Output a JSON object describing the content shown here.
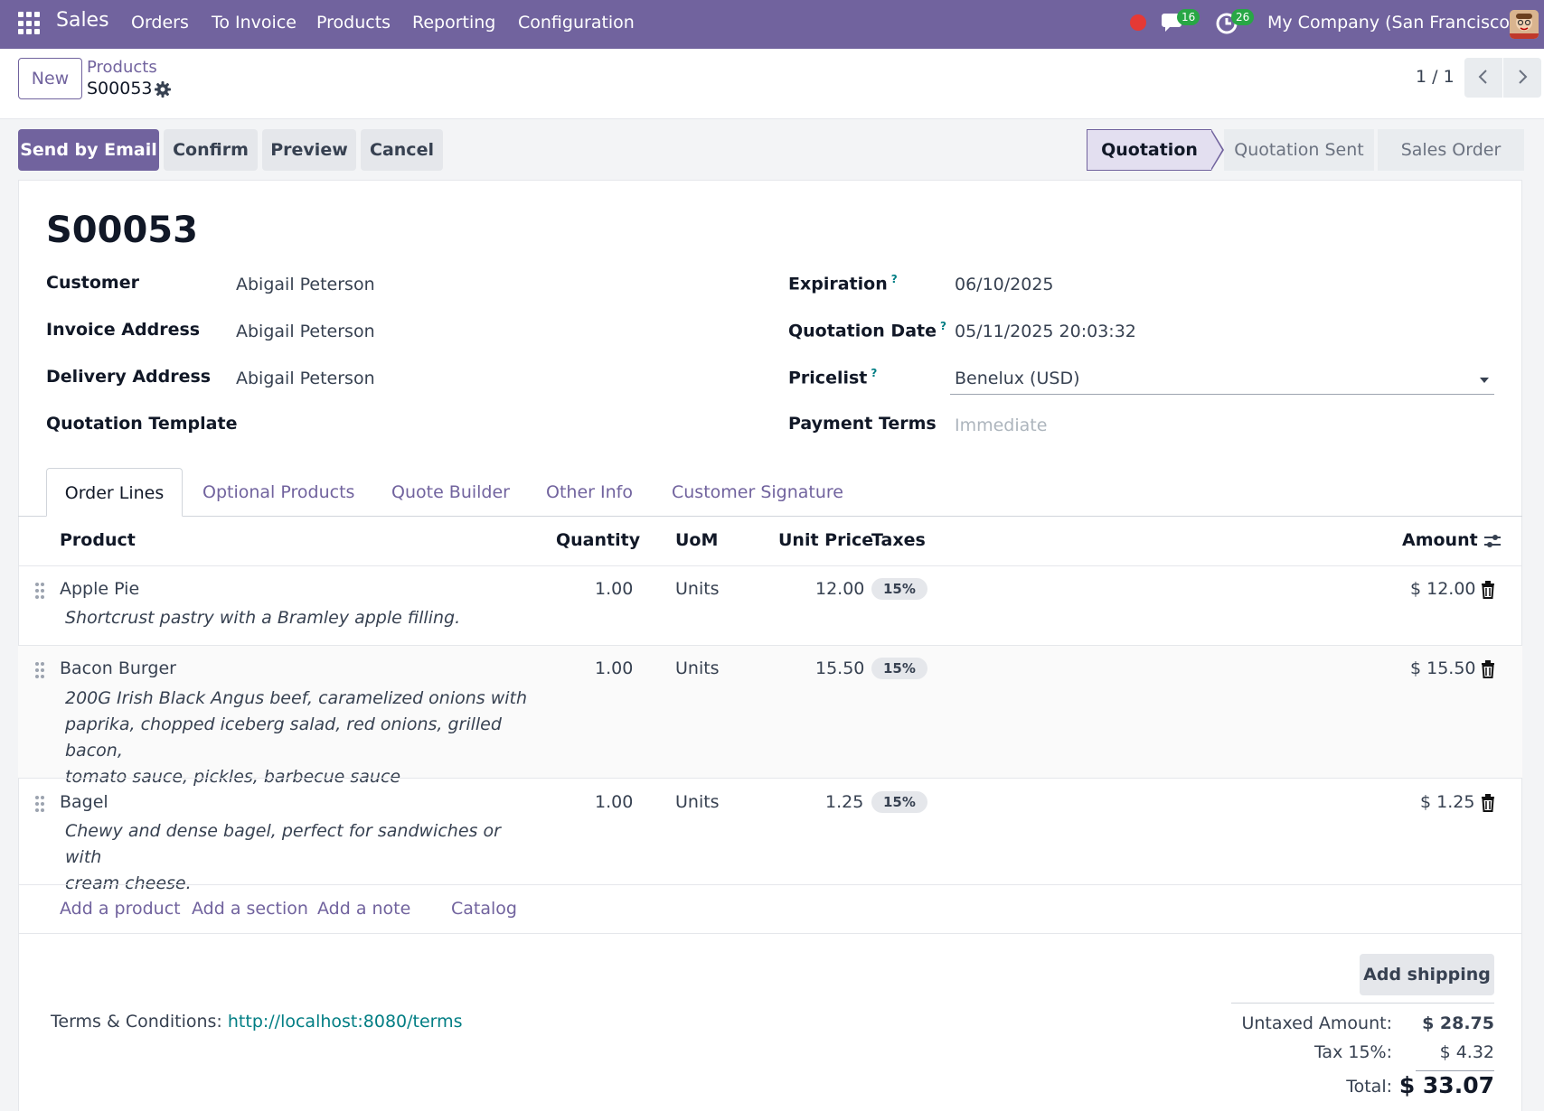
{
  "navbar": {
    "app_name": "Sales",
    "menu": [
      "Orders",
      "To Invoice",
      "Products",
      "Reporting",
      "Configuration"
    ],
    "messages_count": "16",
    "activities_count": "26",
    "company": "My Company (San Francisco)"
  },
  "control_panel": {
    "new_label": "New",
    "breadcrumb_parent": "Products",
    "breadcrumb_current": "S00053",
    "pager": "1 / 1"
  },
  "actions": {
    "send_email": "Send by Email",
    "confirm": "Confirm",
    "preview": "Preview",
    "cancel": "Cancel"
  },
  "statusbar": {
    "stages": [
      "Quotation",
      "Quotation Sent",
      "Sales Order"
    ],
    "active": "Quotation"
  },
  "form": {
    "title": "S00053",
    "customer_label": "Customer",
    "customer": "Abigail Peterson",
    "invoice_address_label": "Invoice Address",
    "invoice_address": "Abigail Peterson",
    "delivery_address_label": "Delivery Address",
    "delivery_address": "Abigail Peterson",
    "quotation_template_label": "Quotation Template",
    "expiration_label": "Expiration",
    "expiration": "06/10/2025",
    "quotation_date_label": "Quotation Date",
    "quotation_date": "05/11/2025 20:03:32",
    "pricelist_label": "Pricelist",
    "pricelist": "Benelux (USD)",
    "payment_terms_label": "Payment Terms",
    "payment_terms_placeholder": "Immediate",
    "help_mark": "?"
  },
  "tabs": [
    "Order Lines",
    "Optional Products",
    "Quote Builder",
    "Other Info",
    "Customer Signature"
  ],
  "table": {
    "headers": {
      "product": "Product",
      "quantity": "Quantity",
      "uom": "UoM",
      "unit_price": "Unit Price",
      "taxes": "Taxes",
      "amount": "Amount"
    },
    "rows": [
      {
        "product": "Apple Pie",
        "desc_lines": [
          "Shortcrust pastry with a Bramley apple filling."
        ],
        "quantity": "1.00",
        "uom": "Units",
        "unit_price": "12.00",
        "tax": "15%",
        "amount": "$ 12.00"
      },
      {
        "product": "Bacon Burger",
        "desc_lines": [
          "200G Irish Black Angus beef, caramelized onions with",
          "paprika, chopped iceberg salad, red onions, grilled bacon,",
          "tomato sauce, pickles, barbecue sauce"
        ],
        "quantity": "1.00",
        "uom": "Units",
        "unit_price": "15.50",
        "tax": "15%",
        "amount": "$ 15.50"
      },
      {
        "product": "Bagel",
        "desc_lines": [
          "Chewy and dense bagel, perfect for sandwiches or with",
          "cream cheese."
        ],
        "quantity": "1.00",
        "uom": "Units",
        "unit_price": "1.25",
        "tax": "15%",
        "amount": "$ 1.25"
      }
    ],
    "add_product": "Add a product",
    "add_section": "Add a section",
    "add_note": "Add a note",
    "catalog": "Catalog"
  },
  "footer": {
    "add_shipping": "Add shipping",
    "terms_label": "Terms & Conditions:",
    "terms_link": "http://localhost:8080/terms",
    "untaxed_label": "Untaxed Amount:",
    "untaxed": "$ 28.75",
    "tax_label": "Tax 15%:",
    "tax": "$ 4.32",
    "total_label": "Total:",
    "total": "$ 33.07"
  },
  "colors": {
    "brand": "#71639e",
    "link_teal": "#017e84",
    "record_dot": "#e53935",
    "badge_green": "#28a745"
  },
  "icons": [
    "apps-grid-icon",
    "record-dot-icon",
    "chat-icon",
    "activity-clock-icon",
    "avatar",
    "gear-icon",
    "chevron-left-icon",
    "chevron-right-icon",
    "drag-handle-icon",
    "trash-icon",
    "column-settings-icon",
    "dropdown-caret-icon"
  ]
}
